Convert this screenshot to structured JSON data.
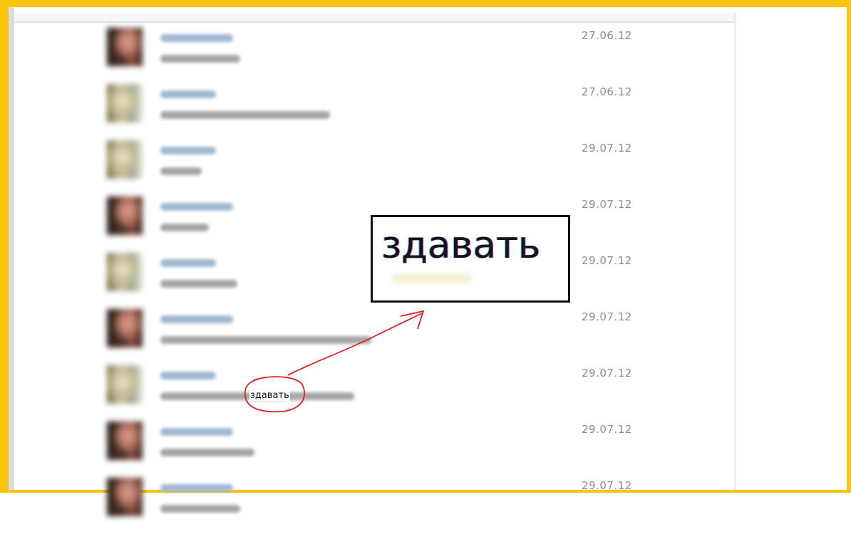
{
  "messages": [
    {
      "avatar": "dark-avatar",
      "date": "27.06.12"
    },
    {
      "avatar": "light-avatar",
      "date": "27.06.12"
    },
    {
      "avatar": "light-avatar",
      "date": "29.07.12"
    },
    {
      "avatar": "dark-avatar",
      "date": "29.07.12"
    },
    {
      "avatar": "light-avatar",
      "date": "29.07.12"
    },
    {
      "avatar": "dark-avatar",
      "date": "29.07.12"
    },
    {
      "avatar": "light-avatar",
      "date": "29.07.12"
    },
    {
      "avatar": "dark-avatar",
      "date": "29.07.12"
    },
    {
      "avatar": "dark-avatar",
      "date": "29.07.12"
    }
  ],
  "annotation": {
    "zoom_word": "здавать",
    "small_word": "здавать"
  },
  "colors": {
    "frame": "#f7c40c",
    "date": "#8c8c8c",
    "annotation_red": "#e02020",
    "name_link": "#9fb8d2"
  }
}
